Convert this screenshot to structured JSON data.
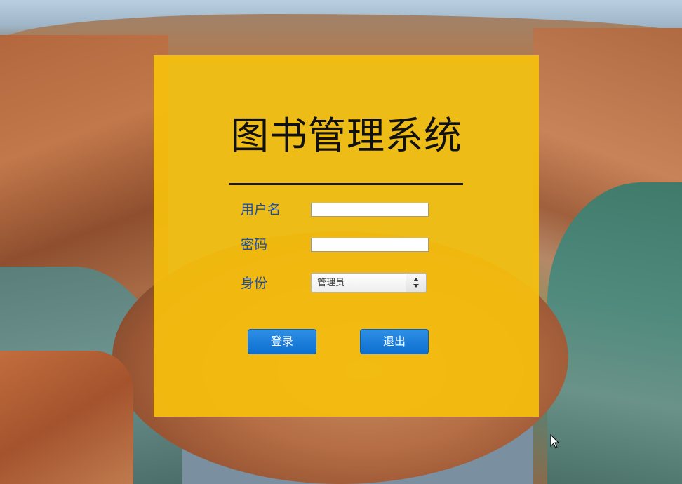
{
  "login": {
    "title": "图书管理系统",
    "username_label": "用户名",
    "username_value": "",
    "password_label": "密码",
    "password_value": "",
    "role_label": "身份",
    "role_selected": "管理员",
    "login_button": "登录",
    "exit_button": "退出"
  },
  "icons": {
    "select_arrow": "updown-arrows-icon",
    "cursor": "mouse-pointer-icon"
  },
  "colors": {
    "panel": "#F6C00D",
    "label_text": "#1F4FA3",
    "button": "#1475D8",
    "title_text": "#111111"
  }
}
